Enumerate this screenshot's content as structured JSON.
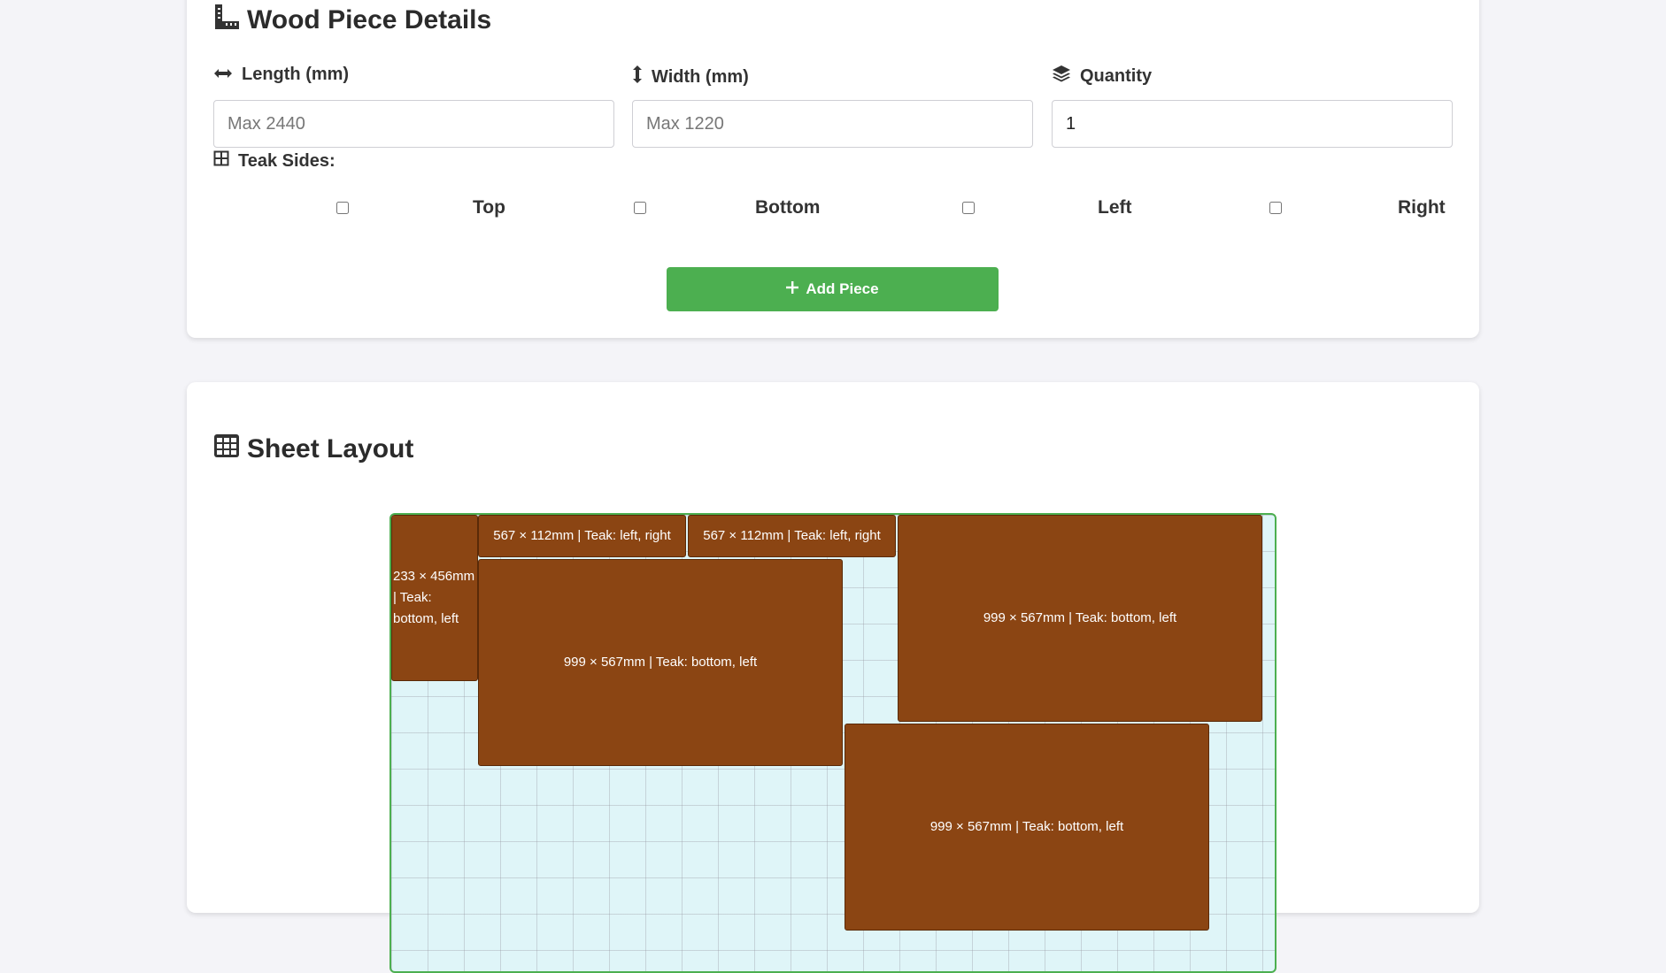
{
  "details": {
    "title": "Wood Piece Details",
    "length_label": "Length  (mm)",
    "length_placeholder": "Max 2440",
    "length_value": "",
    "width_label": "Width  (mm)",
    "width_placeholder": "Max 1220",
    "width_value": "",
    "quantity_label": "Quantity",
    "quantity_value": "1",
    "teak_label": "Teak Sides:",
    "teak_sides": [
      {
        "label": "Top",
        "checked": false
      },
      {
        "label": "Bottom",
        "checked": false
      },
      {
        "label": "Left",
        "checked": false
      },
      {
        "label": "Right",
        "checked": false
      }
    ],
    "add_button": "Add Piece"
  },
  "layout": {
    "title": "Sheet Layout",
    "pieces": [
      {
        "label": "233 × 456mm | Teak: bottom, left",
        "length_mm": 233,
        "width_mm": 456,
        "teak": [
          "bottom",
          "left"
        ]
      },
      {
        "label": "567 × 112mm | Teak: left, right",
        "length_mm": 567,
        "width_mm": 112,
        "teak": [
          "left",
          "right"
        ]
      },
      {
        "label": "567 × 112mm | Teak: left, right",
        "length_mm": 567,
        "width_mm": 112,
        "teak": [
          "left",
          "right"
        ]
      },
      {
        "label": "999 × 567mm | Teak: bottom, left",
        "length_mm": 999,
        "width_mm": 567,
        "teak": [
          "bottom",
          "left"
        ]
      },
      {
        "label": "999 × 567mm | Teak: bottom, left",
        "length_mm": 999,
        "width_mm": 567,
        "teak": [
          "bottom",
          "left"
        ]
      },
      {
        "label": "999 × 567mm | Teak: bottom, left",
        "length_mm": 999,
        "width_mm": 567,
        "teak": [
          "bottom",
          "left"
        ]
      }
    ]
  },
  "colors": {
    "accent": "#4caf50",
    "piece": "#8b4513",
    "sheet": "#dff5f8",
    "background": "#f4f4f8"
  },
  "icons": {
    "details_title": "ruler-icon",
    "length": "arrows-horizontal-icon",
    "width": "arrows-vertical-icon",
    "quantity": "layers-icon",
    "teak_sides": "grid-icon",
    "add_button": "plus-icon",
    "layout_title": "table-icon"
  }
}
